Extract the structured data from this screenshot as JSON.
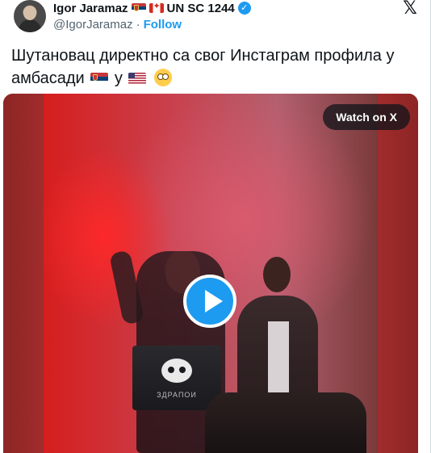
{
  "author": {
    "name": "Igor Jaramaz",
    "name_suffix": "UN SC 1244",
    "handle": "@IgorJaramaz",
    "separator": "·",
    "follow_label": "Follow",
    "verified": true,
    "flags": [
      "serbia-flag-icon",
      "canada-flag-icon"
    ]
  },
  "header": {
    "logo": "x-logo-icon",
    "logo_glyph": "𝕏"
  },
  "tweet": {
    "text_part1": "Шутановац директно са свог Инстаграм профила у амбасади",
    "text_part2": "у",
    "emoji": [
      "serbia-flag-icon",
      "usa-flag-icon",
      "face-with-rolling-eyes-icon"
    ]
  },
  "video": {
    "watch_label": "Watch on X",
    "play_icon": "play-icon",
    "laptop_brand": "ЗДРАПОИ"
  },
  "colors": {
    "accent": "#1d9bf0",
    "text": "#0f1419",
    "muted": "#536471"
  }
}
